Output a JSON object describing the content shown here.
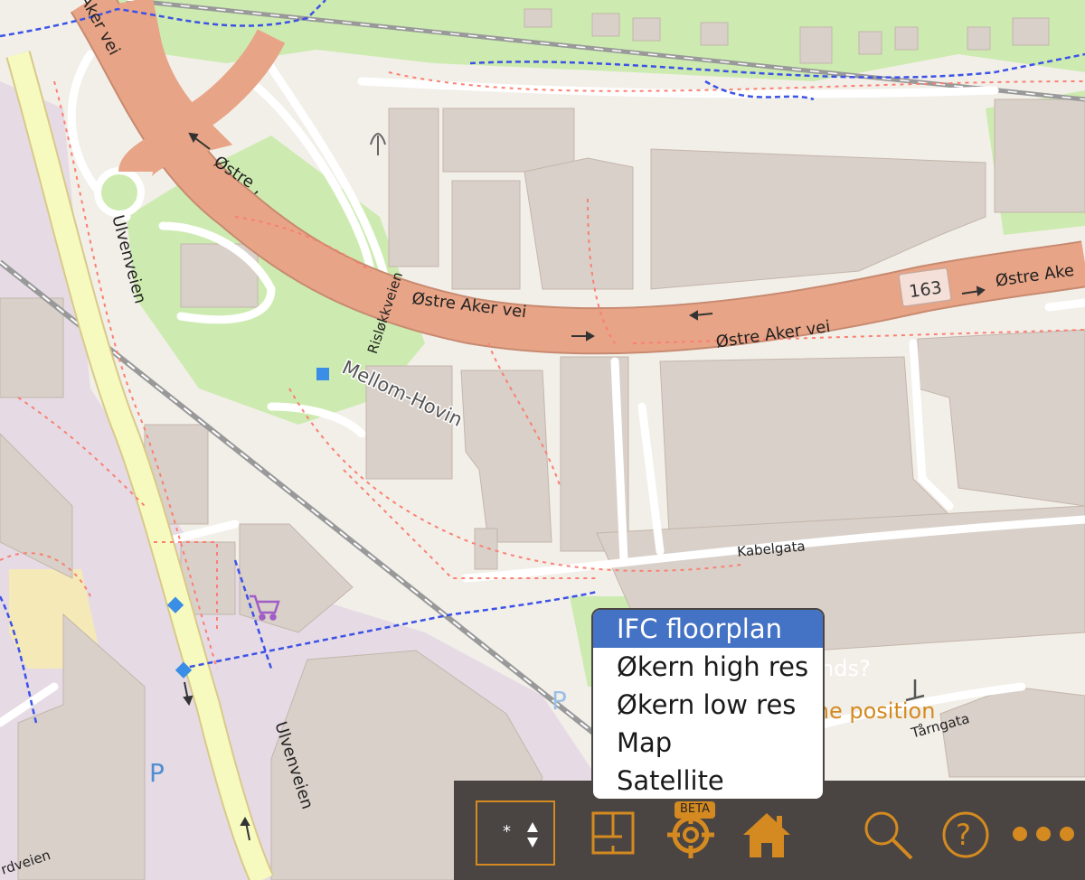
{
  "map": {
    "roads": {
      "ostre_aker_vei_1": "Østre Aker vei",
      "ostre_aker_vei_2": "Østre Aker vei",
      "ostre_aker_vei_3": "Østre Ake",
      "ostre_aker_vei_partial": "Østre ,",
      "ostre_aker_vei_top": "Aker vei",
      "ulvenveien_1": "Ulvenveien",
      "ulvenveien_2": "Ulvenveien",
      "rislokkveien": "Risløkkveien",
      "kabelgata": "Kabelgata",
      "tarngata": "Tårngata",
      "partial_bottom_left": "rdveien"
    },
    "route_shield": "163",
    "place_label": "Mellom-Hovin",
    "parking_label": "P",
    "colors": {
      "background": "#f2efe9",
      "park": "#cdebb0",
      "building": "#d9d0c9",
      "primary_road": "#e8a486",
      "secondary_road": "#f7fabf",
      "residential_area": "#e6dbe5",
      "footpath": "#fa8072",
      "cycleway": "#3c52e6",
      "railway": "#999999"
    }
  },
  "out_of_bounds": {
    "question": "Out of bounds?",
    "link": "Move to home position"
  },
  "layer_menu": {
    "options": [
      "IFC floorplan",
      "Økern high res",
      "Økern low res",
      "Map",
      "Satellite"
    ],
    "selected_index": 0
  },
  "toolbar": {
    "layer_select_value": "*",
    "beta_badge": "BETA",
    "icons": [
      "floorplan-icon",
      "locate-icon",
      "home-icon",
      "search-icon",
      "help-icon",
      "more-icon"
    ],
    "accent_color": "#d48a20",
    "background_color": "#4a4542"
  }
}
